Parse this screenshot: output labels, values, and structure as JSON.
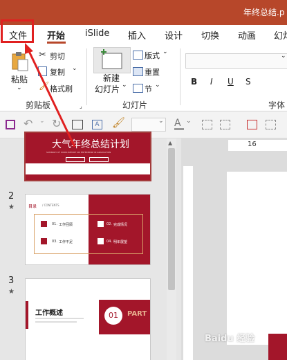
{
  "window": {
    "title": "年终总结.p"
  },
  "tabs": [
    {
      "label": "文件"
    },
    {
      "label": "开始"
    },
    {
      "label": "iSlide"
    },
    {
      "label": "插入"
    },
    {
      "label": "设计"
    },
    {
      "label": "切换"
    },
    {
      "label": "动画"
    },
    {
      "label": "幻灯"
    }
  ],
  "ribbon": {
    "clipboard": {
      "paste_label": "粘贴",
      "cut_label": "剪切",
      "copy_label": "复制",
      "format_painter_label": "格式刷",
      "group_label": "剪贴板"
    },
    "slides": {
      "new_slide_line1": "新建",
      "new_slide_line2": "幻灯片",
      "layout_label": "版式",
      "reset_label": "重置",
      "section_label": "节",
      "group_label": "幻灯片"
    },
    "font": {
      "bold_label": "B",
      "italic_label": "I",
      "underline_label": "U",
      "strike_label": "S",
      "group_label": "字体"
    }
  },
  "ruler": {
    "mark": "16"
  },
  "slides": [
    {
      "number": "",
      "title": "大气年终总结计划",
      "subtitle": "SUMMARY OF WORK REPORT ON ENTERPRISE IN GRADUATION"
    },
    {
      "number": "2",
      "star": "★",
      "header": "目录",
      "header_en": "/ CONTENTS",
      "items": [
        {
          "num": "01.",
          "text": "工作回顾"
        },
        {
          "num": "02.",
          "text": "完成情况"
        },
        {
          "num": "03.",
          "text": "工作不足"
        },
        {
          "num": "04.",
          "text": "明年展望"
        }
      ]
    },
    {
      "number": "3",
      "star": "★",
      "title": "工作概述",
      "badge": "01",
      "part": "PART"
    }
  ],
  "watermark": "Baidu 经验",
  "colors": {
    "accent": "#b7472a",
    "deep_red": "#a3162a",
    "highlight": "#e02020"
  }
}
